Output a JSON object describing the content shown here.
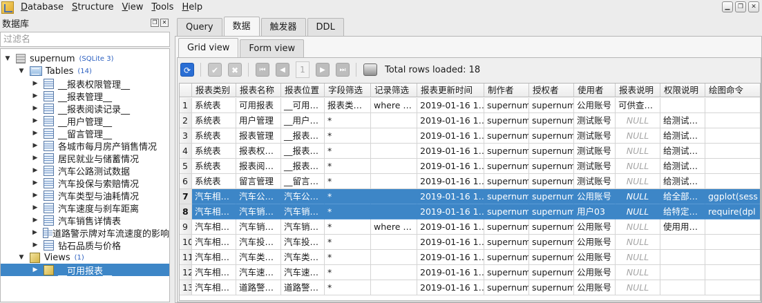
{
  "menu": [
    "Database",
    "Structure",
    "View",
    "Tools",
    "Help"
  ],
  "left_panel": {
    "title": "数据库",
    "filter_placeholder": "过滤名",
    "db_name": "supernum",
    "db_badge": "(SQLite 3)",
    "tables_label": "Tables",
    "tables_count": "(14)",
    "tables": [
      "__报表权限管理__",
      "__报表管理__",
      "__报表阅读记录__",
      "__用户管理__",
      "__留言管理__",
      "各城市每月房产销售情况",
      "居民就业与储蓄情况",
      "汽车公路测试数据",
      "汽车投保与索赔情况",
      "汽车类型与油耗情况",
      "汽车速度与刹车距离",
      "汽车销售详情表",
      "道路警示牌对车流速度的影响",
      "钻石品质与价格"
    ],
    "views_label": "Views",
    "views_count": "(1)",
    "views": [
      "__可用报表__"
    ]
  },
  "main_tabs": [
    "Query",
    "数据",
    "触发器",
    "DDL"
  ],
  "active_main_tab": "数据",
  "sub_tabs": [
    "Grid view",
    "Form view"
  ],
  "active_sub_tab": "Grid view",
  "toolbar": {
    "page_number": "1",
    "total_rows": "Total rows loaded: 18"
  },
  "grid": {
    "columns": [
      "报表类别",
      "报表名称",
      "报表位置",
      "字段筛选",
      "记录筛选",
      "报表更新时间",
      "制作者",
      "授权者",
      "使用者",
      "报表说明",
      "权限说明",
      "绘图命令"
    ],
    "selected_rows": [
      7,
      8
    ],
    "rows": [
      [
        "1",
        "系统表",
        "可用报表",
        "__可用…",
        "报表类…",
        "where …",
        "2019-01-16 1…",
        "supernum",
        "supernum",
        "公用账号",
        "可供查…",
        ""
      ],
      [
        "2",
        "系统表",
        "用户管理",
        "__用户…",
        "*",
        "",
        "2019-01-16 1…",
        "supernum",
        "supernum",
        "测试账号",
        "NULL",
        "给测试…"
      ],
      [
        "3",
        "系统表",
        "报表管理",
        "__报表…",
        "*",
        "",
        "2019-01-16 1…",
        "supernum",
        "supernum",
        "测试账号",
        "NULL",
        "给测试…"
      ],
      [
        "4",
        "系统表",
        "报表权…",
        "__报表…",
        "*",
        "",
        "2019-01-16 1…",
        "supernum",
        "supernum",
        "测试账号",
        "NULL",
        "给测试…"
      ],
      [
        "5",
        "系统表",
        "报表阅…",
        "__报表…",
        "*",
        "",
        "2019-01-16 1…",
        "supernum",
        "supernum",
        "测试账号",
        "NULL",
        "给测试…"
      ],
      [
        "6",
        "系统表",
        "留言管理",
        "__留言…",
        "*",
        "",
        "2019-01-16 1…",
        "supernum",
        "supernum",
        "测试账号",
        "NULL",
        "给测试…"
      ],
      [
        "7",
        "汽车相…",
        "汽车公…",
        "汽车公…",
        "*",
        "",
        "2019-01-16 1…",
        "supernum",
        "supernum",
        "公用账号",
        "NULL",
        "给全部…",
        "ggplot(sess"
      ],
      [
        "8",
        "汽车相…",
        "汽车销…",
        "汽车销…",
        "*",
        "",
        "2019-01-16 1…",
        "supernum",
        "supernum",
        "用户03",
        "NULL",
        "给特定…",
        "require(dpl"
      ],
      [
        "9",
        "汽车相…",
        "汽车销…",
        "汽车销…",
        "*",
        "where …",
        "2019-01-16 1…",
        "supernum",
        "supernum",
        "公用账号",
        "NULL",
        "使用用…",
        ""
      ],
      [
        "10",
        "汽车相…",
        "汽车投…",
        "汽车投…",
        "*",
        "",
        "2019-01-16 1…",
        "supernum",
        "supernum",
        "公用账号",
        "NULL",
        "",
        ""
      ],
      [
        "11",
        "汽车相…",
        "汽车类…",
        "汽车类…",
        "*",
        "",
        "2019-01-16 1…",
        "supernum",
        "supernum",
        "公用账号",
        "NULL",
        "",
        ""
      ],
      [
        "12",
        "汽车相…",
        "汽车速…",
        "汽车速…",
        "*",
        "",
        "2019-01-16 1…",
        "supernum",
        "supernum",
        "公用账号",
        "NULL",
        "",
        ""
      ],
      [
        "13",
        "汽车相…",
        "道路警…",
        "道路警…",
        "*",
        "",
        "2019-01-16 1…",
        "supernum",
        "supernum",
        "公用账号",
        "NULL",
        "",
        ""
      ]
    ]
  }
}
